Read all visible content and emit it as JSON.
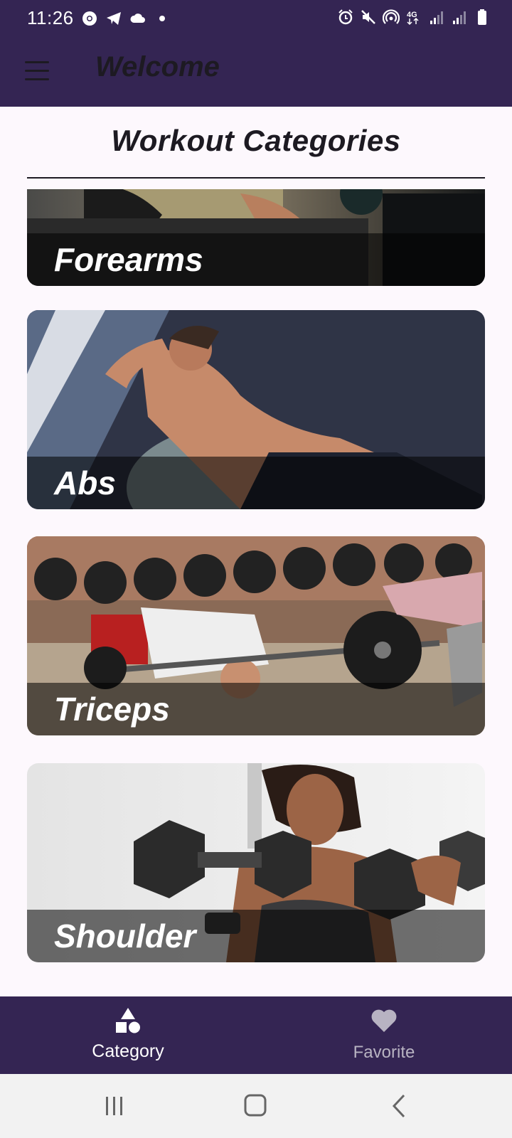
{
  "status_bar": {
    "time": "11:26",
    "left_icons": [
      "chrome-icon",
      "telegram-icon",
      "cloud-icon",
      "dot-icon"
    ],
    "right_icons": [
      "alarm-icon",
      "mute-icon",
      "hotspot-icon",
      "network-4g-icon",
      "signal-icon",
      "signal-icon",
      "battery-icon"
    ],
    "network_label": "4G"
  },
  "app_bar": {
    "menu_icon": "hamburger-menu-icon",
    "title": "Welcome"
  },
  "main": {
    "section_title": "Workout Categories",
    "categories": [
      {
        "label": "Forearms"
      },
      {
        "label": "Abs"
      },
      {
        "label": "Triceps"
      },
      {
        "label": "Shoulder"
      }
    ]
  },
  "bottom_nav": {
    "items": [
      {
        "label": "Category",
        "icon": "category-shapes-icon",
        "selected": true
      },
      {
        "label": "Favorite",
        "icon": "heart-icon",
        "selected": false
      }
    ]
  },
  "system_nav": {
    "items": [
      "recents-icon",
      "home-icon",
      "back-icon"
    ]
  },
  "colors": {
    "app_bar": "#342553",
    "background": "#fdf8fd",
    "text_dark": "#1d1a22",
    "nav_selected": "#ffffff",
    "nav_unselected": "#b8b3c2"
  }
}
